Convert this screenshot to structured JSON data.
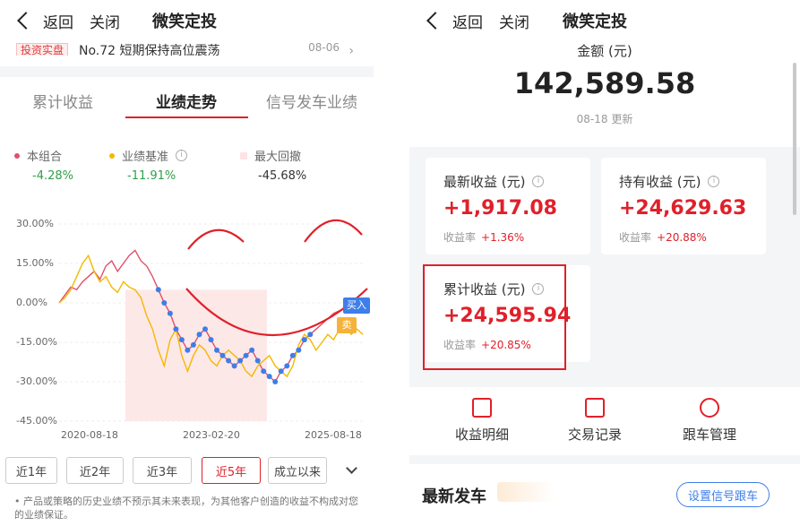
{
  "left": {
    "nav": {
      "back": "返回",
      "close": "关闭",
      "title": "微笑定投"
    },
    "news": {
      "tag": "投资实盘",
      "title": "No.72 短期保持高位震荡",
      "date": "08-06"
    },
    "tabs": [
      "累计收益",
      "业绩走势",
      "信号发车业绩"
    ],
    "legend": [
      {
        "label": "本组合",
        "value": "-4.28%",
        "color": "#e0506a"
      },
      {
        "label": "业绩基准",
        "value": "-11.91%",
        "color": "#f5b800"
      },
      {
        "label": "最大回撤",
        "value": "-45.68%",
        "color": "#fde3e3"
      }
    ],
    "chart_data": {
      "type": "line",
      "y_ticks": [
        "30.00%",
        "15.00%",
        "0.00%",
        "-15.00%",
        "-30.00%",
        "-45.00%"
      ],
      "ylim": [
        -45,
        30
      ],
      "x_ticks": [
        "2020-08-18",
        "2023-02-20",
        "2025-08-18"
      ],
      "series": [
        {
          "name": "本组合",
          "color": "#e0506a",
          "values": [
            0,
            3,
            6,
            5,
            8,
            10,
            12,
            9,
            14,
            16,
            12,
            15,
            18,
            20,
            16,
            14,
            10,
            5,
            0,
            -4,
            -10,
            -14,
            -18,
            -16,
            -12,
            -10,
            -14,
            -18,
            -20,
            -22,
            -24,
            -22,
            -20,
            -18,
            -22,
            -26,
            -28,
            -30,
            -26,
            -24,
            -20,
            -18,
            -14,
            -12,
            -10,
            -8,
            -6,
            -4,
            -3,
            -2,
            0,
            -3,
            -4
          ]
        },
        {
          "name": "业绩基准",
          "color": "#f5b800",
          "values": [
            0,
            2,
            5,
            10,
            15,
            18,
            12,
            8,
            10,
            6,
            4,
            8,
            6,
            5,
            2,
            -5,
            -10,
            -18,
            -24,
            -14,
            -10,
            -20,
            -26,
            -20,
            -16,
            -18,
            -22,
            -24,
            -20,
            -18,
            -20,
            -22,
            -26,
            -28,
            -24,
            -22,
            -20,
            -24,
            -26,
            -28,
            -24,
            -16,
            -12,
            -14,
            -18,
            -15,
            -12,
            -14,
            -10,
            -8,
            -12,
            -10,
            -12
          ]
        }
      ],
      "markers": [
        {
          "label": "买入",
          "color": "#3e7ee8"
        },
        {
          "label": "卖",
          "color": "#f5b23a"
        }
      ]
    },
    "ranges": [
      "近1年",
      "近2年",
      "近3年",
      "近5年",
      "成立以来"
    ],
    "active_range": "近5年",
    "disclaimer": "• 产品或策略的历史业绩不预示其未来表现，为其他客户创造的收益不构成对您的业绩保证。"
  },
  "right": {
    "nav": {
      "back": "返回",
      "close": "关闭",
      "title": "微笑定投"
    },
    "amount": {
      "label": "金额 (元)",
      "value": "142,589.58",
      "updated": "08-18 更新"
    },
    "cards": [
      {
        "title": "最新收益 (元)",
        "value": "+1,917.08",
        "rate_label": "收益率",
        "rate": "+1.36%"
      },
      {
        "title": "持有收益 (元)",
        "value": "+24,629.63",
        "rate_label": "收益率",
        "rate": "+20.88%"
      },
      {
        "title": "累计收益 (元)",
        "value": "+24,595.94",
        "rate_label": "收益率",
        "rate": "+20.85%"
      }
    ],
    "actions": [
      "收益明细",
      "交易记录",
      "跟车管理"
    ],
    "latest": {
      "title": "最新发车",
      "button": "设置信号跟车"
    }
  },
  "colors": {
    "accent": "#e0202a",
    "blue": "#3e7ee8"
  }
}
